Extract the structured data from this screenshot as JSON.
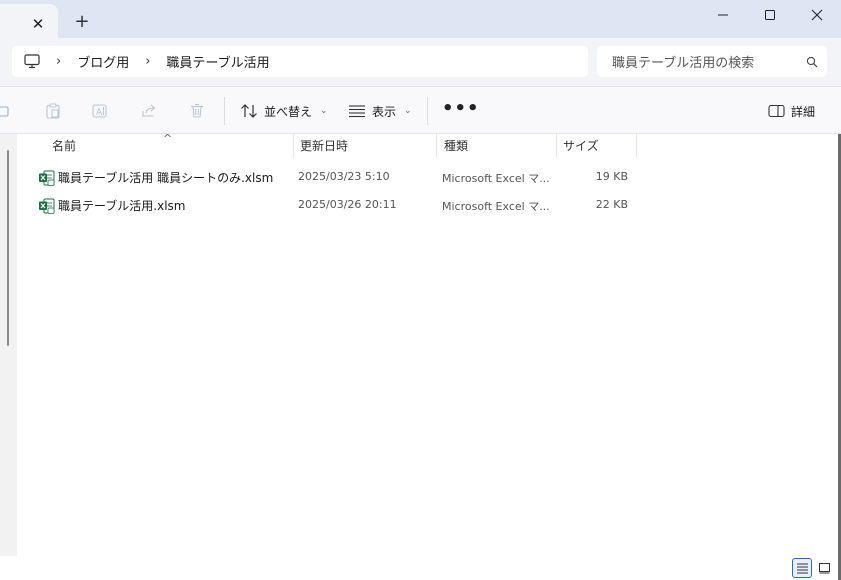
{
  "window": {
    "tab_close": "✕",
    "new_tab": "+"
  },
  "address": {
    "breadcrumb": [
      "ブログ用",
      "職員テーブル活用"
    ],
    "separator": "›"
  },
  "search": {
    "placeholder": "職員テーブル活用の検索"
  },
  "commandbar": {
    "sort_label": "並べ替え",
    "view_label": "表示",
    "more_label": "•••",
    "details_label": "詳細"
  },
  "columns": {
    "name": "名前",
    "modified": "更新日時",
    "type": "種類",
    "size": "サイズ"
  },
  "files": [
    {
      "name": "職員テーブル活用 職員シートのみ.xlsm",
      "modified": "2025/03/23 5:10",
      "type": "Microsoft Excel マ...",
      "size": "19 KB"
    },
    {
      "name": "職員テーブル活用.xlsm",
      "modified": "2025/03/26 20:11",
      "type": "Microsoft Excel マ...",
      "size": "22 KB"
    }
  ],
  "colors": {
    "titlebar": "#dfe6f3",
    "accent": "#2b6cb0",
    "excel_green": "#1d6f42"
  },
  "icons": {
    "computer": "computer-icon",
    "search": "search-icon",
    "sort": "sort-arrows-icon",
    "view": "view-lines-icon",
    "details": "details-pane-icon",
    "file": "excel-file-icon"
  }
}
